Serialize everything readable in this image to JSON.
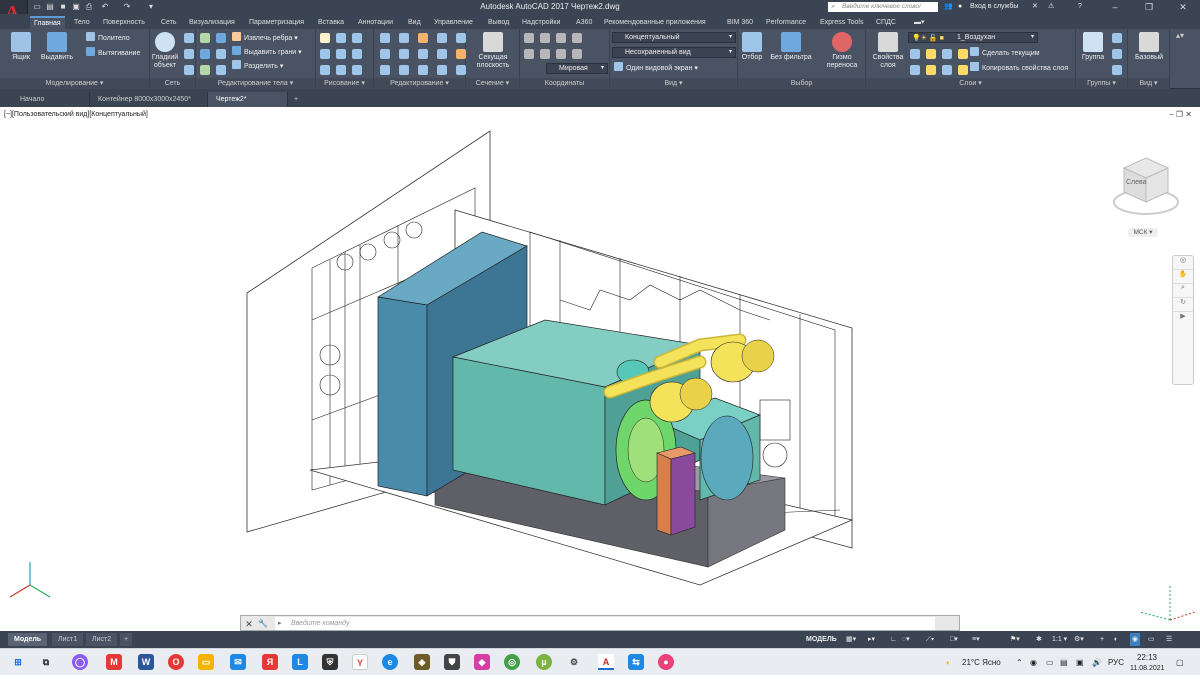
{
  "window": {
    "title": "Autodesk AutoCAD 2017   Чертеж2.dwg",
    "search_placeholder": "Введите ключевое слово/фразу",
    "sign_in": "Вход в службы",
    "controls": [
      "–",
      "❐",
      "✕"
    ]
  },
  "ribbon_tabs": [
    "Главная",
    "Тело",
    "Поверхность",
    "Сеть",
    "Визуализация",
    "Параметризация",
    "Вставка",
    "Аннотации",
    "Вид",
    "Управление",
    "Вывод",
    "Надстройки",
    "A360",
    "Рекомендованные приложения",
    "BIM 360",
    "Performance",
    "Express Tools",
    "СПДС"
  ],
  "ribbon": {
    "modeling": {
      "title": "Моделирование ▾",
      "box": "Ящик",
      "extrude": "Выдавить",
      "polysolid": "Политело",
      "presspull": "Вытягивание"
    },
    "mesh": {
      "title": "Сеть",
      "smooth": "Гладкий объект"
    },
    "solid_edit": {
      "title": "Редактирование тела ▾",
      "extract_edges": "Извлечь ребра ▾",
      "extrude_faces": "Выдавить грани ▾",
      "separate": "Разделить ▾"
    },
    "draw": {
      "title": "Рисование ▾"
    },
    "modify": {
      "title": "Редактирование ▾"
    },
    "section": {
      "title": "Сечение ▾",
      "plane": "Секущая плоскость"
    },
    "coords": {
      "title": "Координаты",
      "world": "Мировая"
    },
    "view": {
      "title": "Вид ▾",
      "visual_style": "Концептуальный",
      "saved_view": "Несохраненный вид",
      "viewport": "Один видовой экран ▾"
    },
    "selection": {
      "title": "Выбор",
      "culling": "Отбор",
      "no_filter": "Без фильтра",
      "gizmo": "Гизмо переноса"
    },
    "layers": {
      "title": "Слои ▾",
      "layer_props": "Свойства слоя",
      "current_layer": "1_Воздухан",
      "make_current": "Сделать текущим",
      "match_layer": "Копировать свойства слоя"
    },
    "groups": {
      "title": "Группы ▾",
      "group": "Группа"
    },
    "viewpanel": {
      "title": "Вид ▾",
      "base": "Базовый"
    }
  },
  "file_tabs": [
    "Начало",
    "Контейнер 8000x3000x2450*",
    "Чертеж2*"
  ],
  "viewport": {
    "label": "[−][Пользовательский вид][Концептуальный]",
    "controls": "− ❐ ✕",
    "viewcube_face": "Слева",
    "ucs": "МСК ▾"
  },
  "command": {
    "placeholder": "Введите команду"
  },
  "layout_tabs": [
    "Модель",
    "Лист1",
    "Лист2"
  ],
  "status": {
    "model": "МОДЕЛЬ",
    "scale": "1:1 ▾"
  },
  "taskbar": {
    "weather": "21°C  Ясно",
    "lang": "РУС",
    "time": "22:13",
    "date": "11.08.2021"
  },
  "colors": {
    "chrome_dark": "#3b4453",
    "ribbon": "#4a5364",
    "panel_blue": "#4a8bab",
    "engine_teal": "#63b8ac",
    "base_gray": "#707078",
    "pipe_yellow": "#f4e25a",
    "generator_green": "#6fd66b",
    "box_orange": "#d77e4b"
  }
}
